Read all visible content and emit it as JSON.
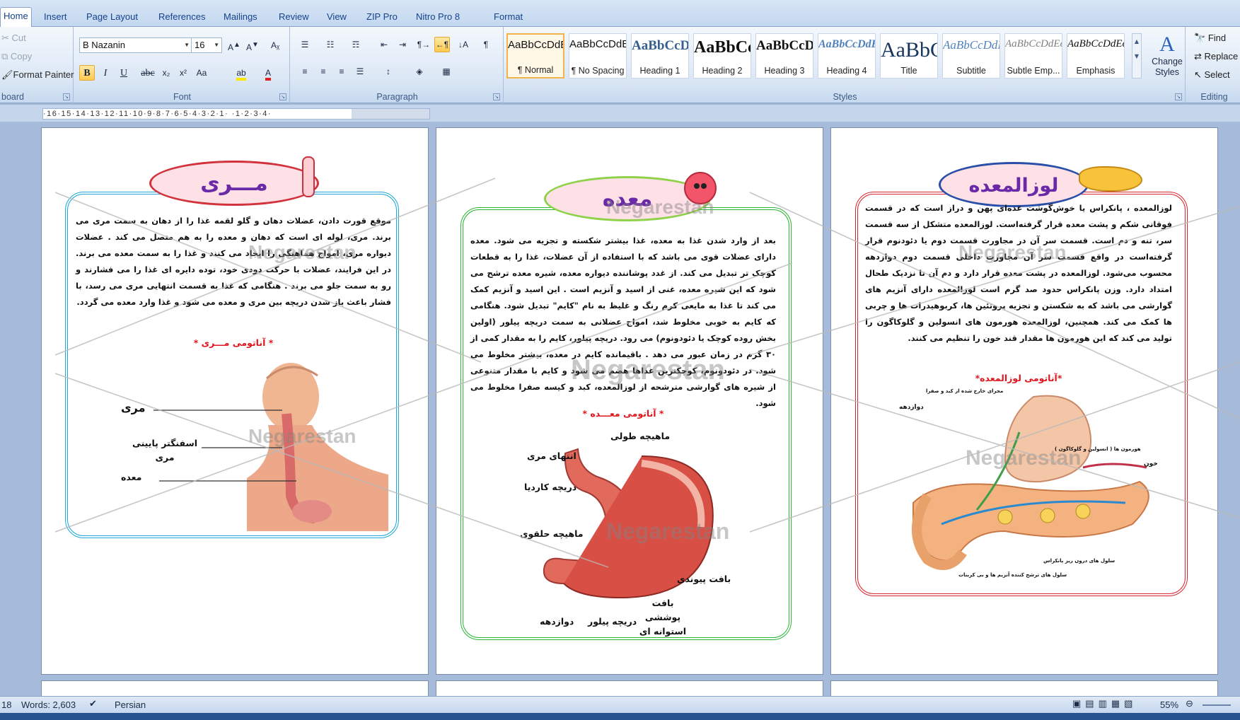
{
  "tabs": [
    "Home",
    "Insert",
    "Page Layout",
    "References",
    "Mailings",
    "Review",
    "View",
    "ZIP Pro",
    "Nitro Pro 8",
    "Format"
  ],
  "clipboard": {
    "cut": "Cut",
    "copy": "Copy",
    "format_painter": "Format Painter",
    "label": "board"
  },
  "font": {
    "name": "B Nazanin",
    "size": "16",
    "label": "Font"
  },
  "paragraph": {
    "label": "Paragraph"
  },
  "styles": {
    "label": "Styles",
    "items": [
      {
        "sample": "AaBbCcDdEe",
        "name": "¶ Normal"
      },
      {
        "sample": "AaBbCcDdEe",
        "name": "¶ No Spacing"
      },
      {
        "sample": "AaBbCcDdEe",
        "name": "Heading 1"
      },
      {
        "sample": "AaBbCcDdEe",
        "name": "Heading 2"
      },
      {
        "sample": "AaBbCcDdEe",
        "name": "Heading 3"
      },
      {
        "sample": "AaBbCcDdEe",
        "name": "Heading 4"
      },
      {
        "sample": "AaBbCcDdEe",
        "name": "Title"
      },
      {
        "sample": "AaBbCcDdEe",
        "name": "Subtitle"
      },
      {
        "sample": "AaBbCcDdEe",
        "name": "Subtle Emp..."
      },
      {
        "sample": "AaBbCcDdEe",
        "name": "Emphasis"
      }
    ],
    "change_styles": "Change Styles"
  },
  "editing": {
    "find": "Find",
    "replace": "Replace",
    "select": "Select",
    "label": "Editing"
  },
  "ruler": "·16·15·14·13·12·11·10·9·8·7·6·5·4·3·2·1·  ·1·2·3·4·",
  "watermark": "Negarestan",
  "pages": {
    "esophagus": {
      "title": "مـــری",
      "text": "موقع قورت دادن، عضلات دهان و گلو لقمه غذا را از دهان به سمت مری می برند. مری، لوله ای است که دهان و معده را به هم متصل می کند . عضلات دیواره مری، امواج هماهنگی را ایجاد می کنند و غذا را به سمت معده می برند. در این فرایند، عضلات با حرکت دودی خود، توده دایره ای غذا را می فشارند و رو به سمت جلو می برند . هنگامی که غذا به قسمت انتهایی مری می رسد، با فشار باعث باز شدن دریچه بین مری و معده می شود و غذا وارد معده می گردد.",
      "caption": "* آناتومی مـــری *",
      "labels": [
        "مری",
        "اسفنگتر پایینی مری",
        "معده"
      ]
    },
    "stomach": {
      "title": "معده",
      "text": "بعد از وارد شدن غذا به معده، غذا بیشتر شکسته و تجزیه می شود. معده دارای عضلات قوی می باشد که با استفاده از آن عضلات، غذا را به قطعات کوچک تر تبدیل می کند. از غدد پوشاننده دیواره معده، شیره معده ترشح می شود که این شیره معده، غنی از اسید و آنزیم است . این اسید و آنزیم کمک می کند تا غذا به مایعی کرم رنگ و غلیظ به نام \"کایم\" تبدیل شود. هنگامی که کایم به خوبی مخلوط شد، امواج عضلانی به سمت دریچه پیلور (اولین بخش روده کوچک یا دئودونوم) می رود. دریچه پیلور، کایم را به مقدار کمی از ۳۰ گرم در زمان عبور می دهد . باقیمانده کایم در معده، بیشتر مخلوط می شود. در دئودونوم، کوچکترین غذاها هضم می شود و کایم با مقدار متنوعی از شیره های گوارشی مترشحه از لوزالمعده، کبد و کیسه صفرا مخلوط می شود.",
      "caption": "* آناتومی معـــده *",
      "labels": [
        "ماهیچه طولی",
        "انتهای مری",
        "دریچه کاردیا",
        "ماهیچه حلقوی",
        "بافت پیوندی",
        "بافت پوششی استوانه ای",
        "دوازدهه",
        "دریچه پیلور"
      ]
    },
    "pancreas": {
      "title": "لوزالمعده",
      "text": "لوزالمعده ، پانکراس یا خوش‌گوشت غده‌ای پهن و دراز است که در قسمت فوقانی شکم و پشت معده قرار گرفته‌است. لوزالمعده متشکل از سه قسمت سر، تنه و دم است. قسمت سر آن در مجاورت قسمت دوم یا دئودنوم قرار گرفته‌است در واقع قسمت سر آن مجاورت داخلی قسمت دوم دوازدهه محسوب می‌شود. لوزالمعده در پشت معده قرار دارد و دم آن تا نزدیک طحال امتداد دارد. وزن پانکراس حدود صد گرم است لوزالمعده دارای آنزیم های گوارشی می باشد که به شکستن و تجزیه پروتئین ها، کربوهیدرات ها و چربی ها کمک می کند. همچنین، لوزالمعده هورمون های انسولین و گلوکاگون را تولید می کند که این هورمون ها مقدار قند خون را تنظیم می کنند.",
      "caption": "*آناتومی لوزالمعده*",
      "labels": [
        "مجرای خارج شده از کبد و صفرا",
        "دوازدهه",
        "هورمون ها ( انسولین و گلوکاگون )",
        "خون",
        "سلول های ترشح کننده آنزیم ها و بی کربنات",
        "سلول های درون ریز پانکراس"
      ]
    }
  },
  "status": {
    "page": "18",
    "words": "Words: 2,603",
    "language": "Persian",
    "zoom": "55%"
  },
  "colors": {
    "esophagus": "#1ea7d8",
    "stomach": "#2bb534",
    "pancreas": "#d8262e",
    "title_text": "#6a2aa8"
  }
}
